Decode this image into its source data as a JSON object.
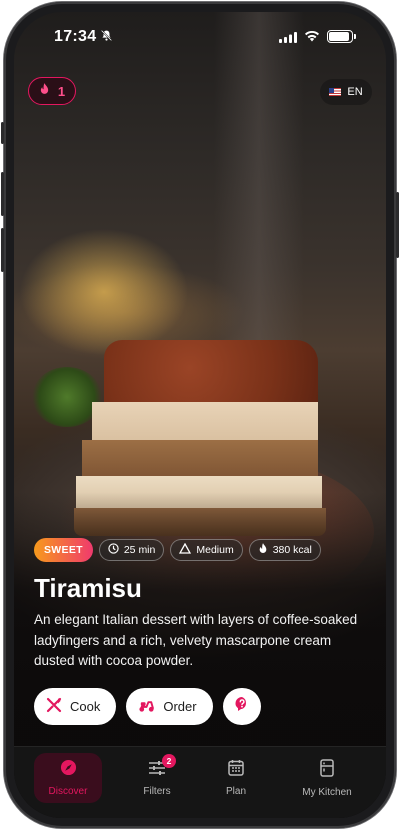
{
  "status_bar": {
    "time": "17:34",
    "icons": [
      "bell-off-icon",
      "signal-icon",
      "wifi-icon",
      "battery-icon"
    ]
  },
  "header": {
    "streak_count": "1",
    "language": "EN",
    "flag": "us-flag"
  },
  "recipe": {
    "category": "SWEET",
    "time": "25 min",
    "difficulty": "Medium",
    "calories": "380 kcal",
    "title": "Tiramisu",
    "description": "An elegant Italian dessert with layers of coffee-soaked ladyfingers and a rich, velvety mascarpone cream dusted with cocoa powder."
  },
  "actions": {
    "cook_label": "Cook",
    "order_label": "Order"
  },
  "tabs": {
    "discover": "Discover",
    "filters": "Filters",
    "filters_badge": "2",
    "plan": "Plan",
    "my_kitchen": "My Kitchen"
  },
  "colors": {
    "accent": "#e3175f",
    "sweet_start": "#f79a1c",
    "sweet_end": "#f03a6d"
  }
}
